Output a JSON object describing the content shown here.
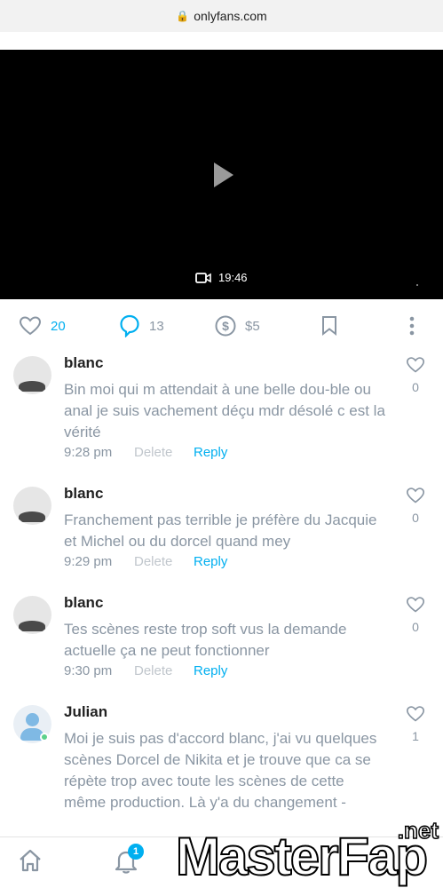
{
  "browser": {
    "url": "onlyfans.com"
  },
  "video": {
    "duration": "19:46"
  },
  "actions": {
    "likes": "20",
    "comments": "13",
    "tip": "$5"
  },
  "comments": [
    {
      "name": "blanc",
      "text": "Bin moi qui m attendait à une belle dou-ble ou anal je suis vachement déçu mdr désolé c est la vérité",
      "time": "9:28 pm",
      "delete": "Delete",
      "reply": "Reply",
      "likes": "0"
    },
    {
      "name": "blanc",
      "text": "Franchement pas terrible je préfère du Jacquie et Michel ou du dorcel quand mey",
      "time": "9:29 pm",
      "delete": "Delete",
      "reply": "Reply",
      "likes": "0"
    },
    {
      "name": "blanc",
      "text": "Tes scènes reste trop soft vus la demande actuelle ça ne peut fonctionner",
      "time": "9:30 pm",
      "delete": "Delete",
      "reply": "Reply",
      "likes": "0"
    },
    {
      "name": "Julian",
      "text": "Moi je suis pas d'accord blanc, j'ai vu quelques scènes Dorcel de Nikita et je trouve que ca se répète trop avec toute les scènes de cette même production. Là y'a du changement -",
      "likes": "1"
    }
  ],
  "nav": {
    "notifications_badge": "1"
  },
  "watermark": {
    "text": "MasterFap",
    "suffix": ".net"
  },
  "colors": {
    "accent": "#00aff0",
    "muted": "#8a96a3"
  }
}
